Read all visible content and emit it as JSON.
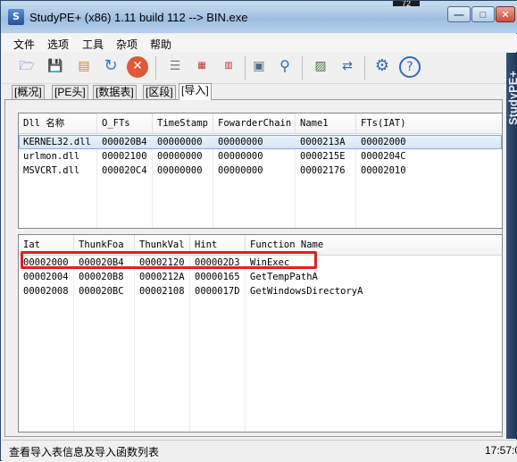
{
  "window": {
    "title": "StudyPE+ (x86) 1.11 build 112  --> BIN.exe",
    "clock_snip": "72"
  },
  "menu": [
    "文件",
    "选项",
    "工具",
    "杂项",
    "帮助"
  ],
  "toolbar": {
    "icons": [
      "open-file-icon",
      "save-icon",
      "view-icon",
      "refresh-icon",
      "close-file-icon",
      "database-icon",
      "hex-icon",
      "compare-icon",
      "calculator-icon",
      "search-icon",
      "image-icon",
      "network-icon",
      "settings-icon",
      "help-icon"
    ]
  },
  "tabs": [
    "[概况]",
    "[PE头]",
    "[数据表]",
    "[区段]",
    "[导入]"
  ],
  "active_tab": "[导入]",
  "dll_table": {
    "headers": [
      "Dll 名称",
      "O_FTs",
      "TimeStamp",
      "FowarderChain",
      "Name1",
      "FTs(IAT)"
    ],
    "rows": [
      [
        "KERNEL32.dll",
        "000020B4",
        "00000000",
        "00000000",
        "0000213A",
        "00002000"
      ],
      [
        "urlmon.dll",
        "00002100",
        "00000000",
        "00000000",
        "0000215E",
        "0000204C"
      ],
      [
        "MSVCRT.dll",
        "000020C4",
        "00000000",
        "00000000",
        "00002176",
        "00002010"
      ]
    ]
  },
  "func_table": {
    "headers": [
      "Iat",
      "ThunkFoa",
      "ThunkVal",
      "Hint",
      "Function Name"
    ],
    "rows": [
      [
        "00002000",
        "000020B4",
        "00002120",
        "000002D3",
        "WinExec"
      ],
      [
        "00002004",
        "000020B8",
        "0000212A",
        "00000165",
        "GetTempPathA"
      ],
      [
        "00002008",
        "000020BC",
        "00002108",
        "0000017D",
        "GetWindowsDirectoryA"
      ]
    ]
  },
  "status": {
    "text": "查看导入表信息及导入函数列表",
    "time": "17:57:0"
  },
  "side_brand": "StudyPE+",
  "colors": {
    "highlight": "#e02020",
    "selection": "#d3e6f7"
  }
}
